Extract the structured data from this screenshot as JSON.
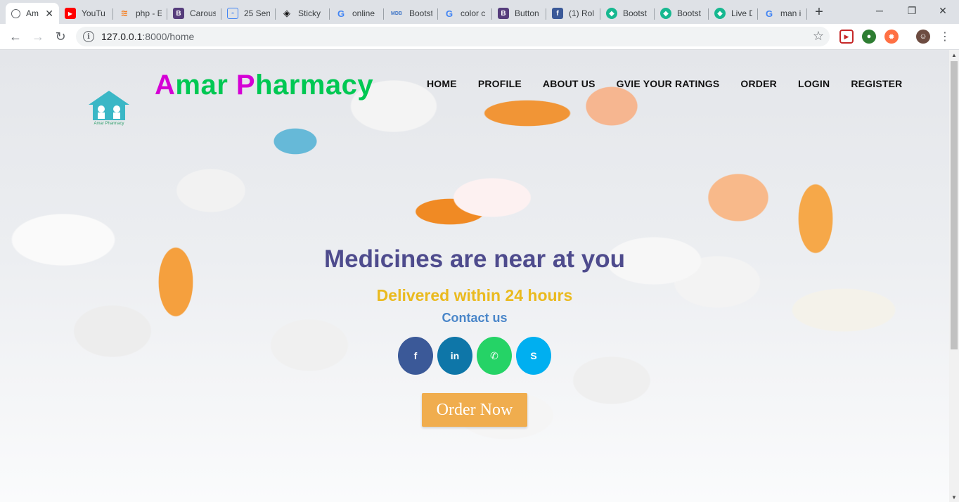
{
  "browser": {
    "tabs": [
      {
        "title": "Am",
        "active": true,
        "icon": "globe-icon",
        "color": "#5f6368"
      },
      {
        "title": "YouTu",
        "icon": "youtube-icon",
        "color": "#ff0000"
      },
      {
        "title": "php - E",
        "icon": "stackoverflow-icon",
        "color": "#f48024"
      },
      {
        "title": "Carous",
        "icon": "bootstrap-icon",
        "color": "#563d7c"
      },
      {
        "title": "25 Sen",
        "icon": "doc-icon",
        "color": "#4285f4"
      },
      {
        "title": "Sticky",
        "icon": "codepen-icon",
        "color": "#111111"
      },
      {
        "title": "online",
        "icon": "google-icon",
        "color": "#4285f4"
      },
      {
        "title": "Bootst",
        "icon": "mdb-icon",
        "color": "#3f75c7"
      },
      {
        "title": "color c",
        "icon": "google-icon",
        "color": "#4285f4"
      },
      {
        "title": "Button",
        "icon": "bootstrap-icon",
        "color": "#563d7c"
      },
      {
        "title": "(1) Rol",
        "icon": "facebook-icon",
        "color": "#3b5998"
      },
      {
        "title": "Bootst",
        "icon": "hexagon-icon",
        "color": "#17b890"
      },
      {
        "title": "Bootst",
        "icon": "hexagon-icon",
        "color": "#17b890"
      },
      {
        "title": "Live D",
        "icon": "hexagon-icon",
        "color": "#17b890"
      },
      {
        "title": "man ic",
        "icon": "google-icon",
        "color": "#4285f4"
      }
    ],
    "url_host": "127.0.0.1",
    "url_path": ":8000/home"
  },
  "site": {
    "brand_a": "A",
    "brand_mar": "mar ",
    "brand_p": "P",
    "brand_harmacy": "harmacy",
    "logo_caption": "Amar Pharmacy",
    "nav": [
      "HOME",
      "PROFILE",
      "ABOUT US",
      "GVIE YOUR RATINGS",
      "ORDER",
      "LOGIN",
      "REGISTER"
    ]
  },
  "hero": {
    "headline": "Medicines are near at you",
    "subheadline": "Delivered within 24 hours",
    "contact": "Contact us",
    "socials": [
      {
        "name": "facebook",
        "glyph": "f",
        "color": "#3b5998"
      },
      {
        "name": "linkedin",
        "glyph": "in",
        "color": "#0e76a8"
      },
      {
        "name": "whatsapp",
        "glyph": "✆",
        "color": "#25d366"
      },
      {
        "name": "skype",
        "glyph": "S",
        "color": "#00aff0"
      }
    ],
    "order_button": "Order Now"
  },
  "colors": {
    "brand_green": "#00c853",
    "brand_magenta": "#d500d5",
    "headline": "#4e4b8d",
    "subheadline": "#eaba1f",
    "contact": "#4a86c9",
    "order_button": "#f0ad4e"
  }
}
